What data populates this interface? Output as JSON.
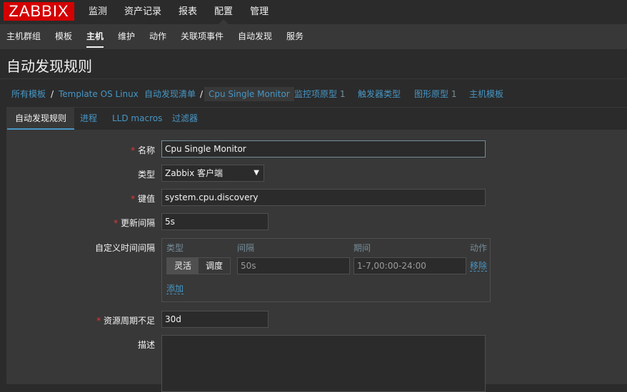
{
  "logo": "ZABBIX",
  "main_menu": [
    "监测",
    "资产记录",
    "报表",
    "配置",
    "管理"
  ],
  "sub_menu": [
    "主机群组",
    "模板",
    "主机",
    "维护",
    "动作",
    "关联项事件",
    "自动发现",
    "服务"
  ],
  "page_title": "自动发现规则",
  "breadcrumbs": {
    "all_templates": "所有模板",
    "template": "Template OS Linux",
    "discovery_list": "自动发现清单",
    "current": "Cpu Single Monitor",
    "item_prototypes": "监控项原型",
    "item_prototypes_count": "1",
    "trigger_types": "触发器类型",
    "graph_prototypes": "图形原型",
    "graph_prototypes_count": "1",
    "host_templates": "主机模板"
  },
  "tabs": [
    "自动发现规则",
    "进程",
    "LLD macros",
    "过滤器"
  ],
  "form": {
    "name_label": "名称",
    "name_value": "Cpu Single Monitor",
    "type_label": "类型",
    "type_value": "Zabbix 客户端",
    "key_label": "键值",
    "key_value": "system.cpu.discovery",
    "interval_label": "更新间隔",
    "interval_value": "5s",
    "custom_interval_label": "自定义时间间隔",
    "custom_interval": {
      "col_type": "类型",
      "col_interval": "间隔",
      "col_period": "期间",
      "col_action": "动作",
      "seg_flexible": "灵活",
      "seg_scheduling": "调度",
      "interval_value": "50s",
      "period_value": "1-7,00:00-24:00",
      "remove_label": "移除",
      "add_label": "添加"
    },
    "lifetime_label": "资源周期不足",
    "lifetime_value": "30d",
    "description_label": "描述",
    "required_mark": "*"
  },
  "colors": {
    "brand": "#d40000",
    "link": "#4796c4",
    "required": "#e33734",
    "background": "#2b2b2b",
    "panel": "#383838"
  }
}
